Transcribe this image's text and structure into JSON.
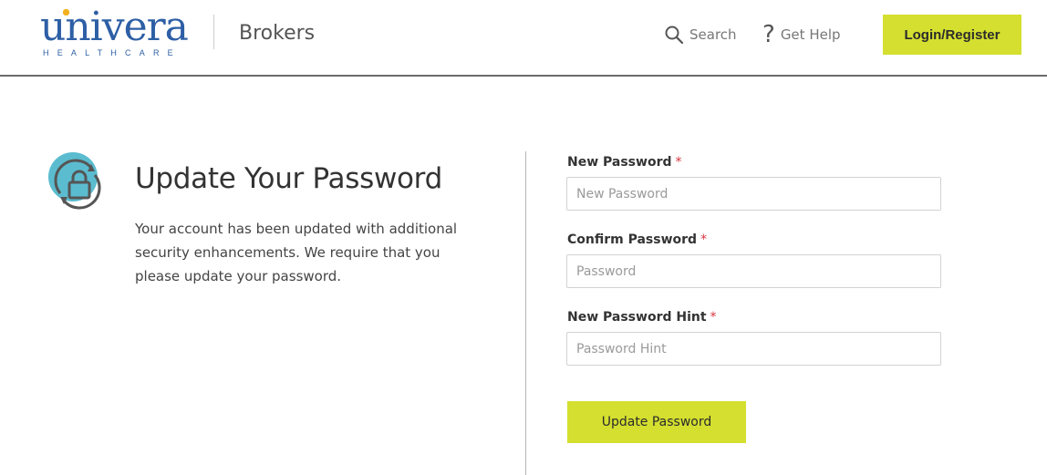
{
  "header": {
    "logo": {
      "word": "univera",
      "sub": "HEALTHCARE"
    },
    "section": "Brokers",
    "search_label": "Search",
    "help_label": "Get Help",
    "login_label": "Login/Register"
  },
  "intro": {
    "title": "Update Your Password",
    "description": "Your account has been updated with additional security enhancements. We require that you please update your password."
  },
  "form": {
    "new_password": {
      "label": "New Password",
      "required_mark": "*",
      "value": "",
      "placeholder": "New Password"
    },
    "confirm_password": {
      "label": "Confirm Password",
      "required_mark": "*",
      "value": "",
      "placeholder": "Password"
    },
    "password_hint": {
      "label": "New Password Hint",
      "required_mark": "*",
      "value": "",
      "placeholder": "Password Hint"
    },
    "submit_label": "Update Password"
  },
  "icons": {
    "search": "search-icon",
    "help": "question-mark-icon",
    "lock": "lock-refresh-icon"
  },
  "colors": {
    "brand_blue": "#2d5fa5",
    "accent_lime": "#d4df2f",
    "required_red": "#d9363e",
    "icon_teal": "#5bbccf"
  }
}
